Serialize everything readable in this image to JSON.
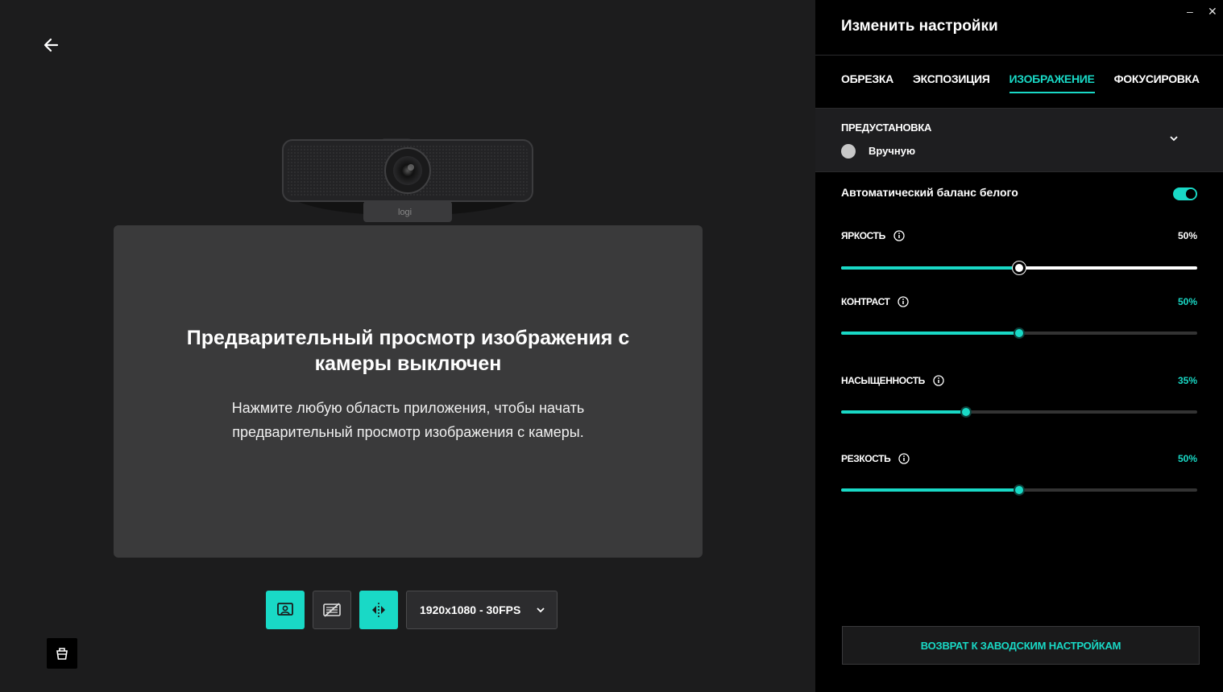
{
  "preview": {
    "title": "Предварительный просмотр изображения с камеры выключен",
    "message": "Нажмите любую область приложения, чтобы начать предварительный просмотр изображения с камеры.",
    "webcam_logo": "logi"
  },
  "controls": {
    "resolution": "1920x1080 - 30FPS"
  },
  "panel": {
    "title": "Изменить настройки",
    "tabs": [
      {
        "label": "ОБРЕЗКА"
      },
      {
        "label": "ЭКСПОЗИЦИЯ"
      },
      {
        "label": "ИЗОБРАЖЕНИЕ"
      },
      {
        "label": "ФОКУСИРОВКА"
      }
    ],
    "active_tab": 2,
    "preset": {
      "label": "ПРЕДУСТАНОВКА",
      "value": "Вручную"
    },
    "auto_white_balance": {
      "label": "Автоматический баланс белого",
      "on": true
    },
    "sliders": [
      {
        "label": "ЯРКОСТЬ",
        "value_text": "50%",
        "value": 50
      },
      {
        "label": "КОНТРАСТ",
        "value_text": "50%",
        "value": 50
      },
      {
        "label": "НАСЫЩЕННОСТЬ",
        "value_text": "35%",
        "value": 35
      },
      {
        "label": "РЕЗКОСТЬ",
        "value_text": "50%",
        "value": 50
      }
    ],
    "reset_label": "ВОЗВРАТ К ЗАВОДСКИМ НАСТРОЙКАМ"
  },
  "colors": {
    "accent": "#19d9c6",
    "panel_bg": "#000000",
    "preview_bg": "#3a3a3b"
  }
}
